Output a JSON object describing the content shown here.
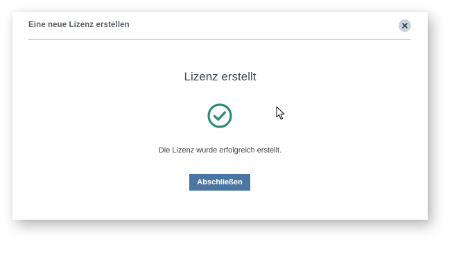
{
  "dialog": {
    "title": "Eine neue Lizenz erstellen",
    "close_icon": "close-icon",
    "heading": "Lizenz erstellt",
    "status_icon": "check-circle-icon",
    "message": "Die Lizenz wurde erfolgreich erstellt.",
    "primary_button_label": "Abschließen"
  },
  "colors": {
    "accent": "#4a76a4",
    "success": "#2e8b74",
    "close_button_bg": "#c9d4df"
  }
}
